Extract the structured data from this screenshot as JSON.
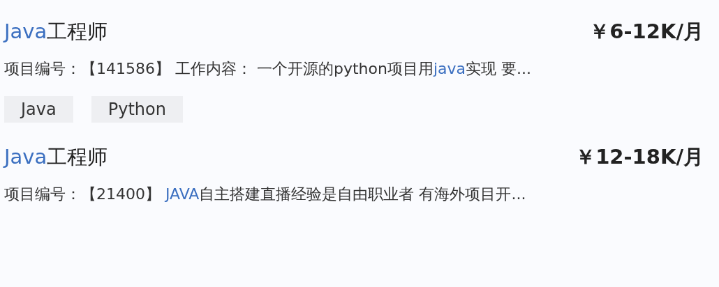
{
  "jobs": [
    {
      "title": [
        {
          "text": "Java",
          "highlight": true
        },
        {
          "text": "工程师",
          "highlight": false
        }
      ],
      "salary": "￥6-12K/月",
      "description": [
        {
          "text": "项目编号：【141586】 工作内容： 一个开源的python项目用",
          "highlight": false
        },
        {
          "text": "java",
          "highlight": true
        },
        {
          "text": "实现 要...",
          "highlight": false
        }
      ],
      "tags": [
        "Java",
        "Python"
      ]
    },
    {
      "title": [
        {
          "text": "Java",
          "highlight": true
        },
        {
          "text": "工程师",
          "highlight": false
        }
      ],
      "salary": "￥12-18K/月",
      "description": [
        {
          "text": "项目编号：【21400】 ",
          "highlight": false
        },
        {
          "text": "JAVA",
          "highlight": true
        },
        {
          "text": "自主搭建直播经验是自由职业者 有海外项目开...",
          "highlight": false
        }
      ]
    }
  ]
}
